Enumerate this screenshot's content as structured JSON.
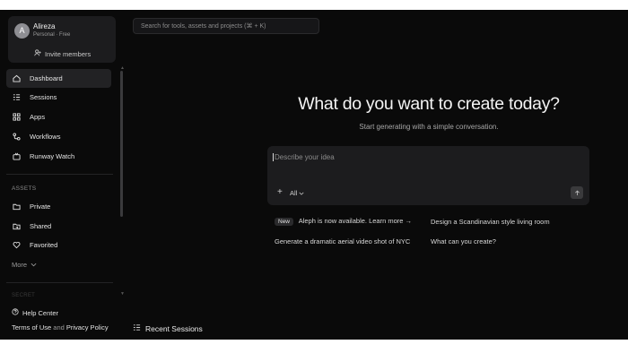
{
  "account": {
    "avatar_letter": "A",
    "name": "Alireza",
    "plan": "Personal · Free",
    "invite_label": "Invite members"
  },
  "nav": {
    "items": [
      {
        "label": "Dashboard",
        "icon": "home-icon",
        "active": true
      },
      {
        "label": "Sessions",
        "icon": "sessions-icon"
      },
      {
        "label": "Apps",
        "icon": "apps-grid-icon"
      },
      {
        "label": "Workflows",
        "icon": "workflow-icon"
      },
      {
        "label": "Runway Watch",
        "icon": "tv-icon"
      }
    ],
    "assets_label": "ASSETS",
    "assets": [
      {
        "label": "Private",
        "icon": "folder-icon"
      },
      {
        "label": "Shared",
        "icon": "shared-folder-icon"
      },
      {
        "label": "Favorited",
        "icon": "heart-icon"
      }
    ],
    "more_label": "More",
    "faded_label": "SECRET"
  },
  "footer": {
    "help_label": "Help Center",
    "terms_label": "Terms of Use",
    "and_label": "and",
    "privacy_label": "Privacy Policy"
  },
  "search": {
    "placeholder": "Search for tools, assets and projects (⌘ + K)"
  },
  "main": {
    "headline": "What do you want to create today?",
    "subline": "Start generating with a simple conversation.",
    "prompt_placeholder": "Describe your idea",
    "mode_label": "All",
    "suggestions": {
      "badge": "New",
      "s1": "Aleph is now available. Learn more →",
      "s2": "Design a Scandinavian style living room",
      "s3": "Generate a dramatic aerial video shot of NYC",
      "s4": "What can you create?"
    },
    "recent_label": "Recent Sessions"
  },
  "colors": {
    "background": "#0a0a0a",
    "panel": "#1c1c1e",
    "active_nav": "#222224",
    "text_primary": "#f4f4f4",
    "text_muted": "#8c8c8c"
  }
}
